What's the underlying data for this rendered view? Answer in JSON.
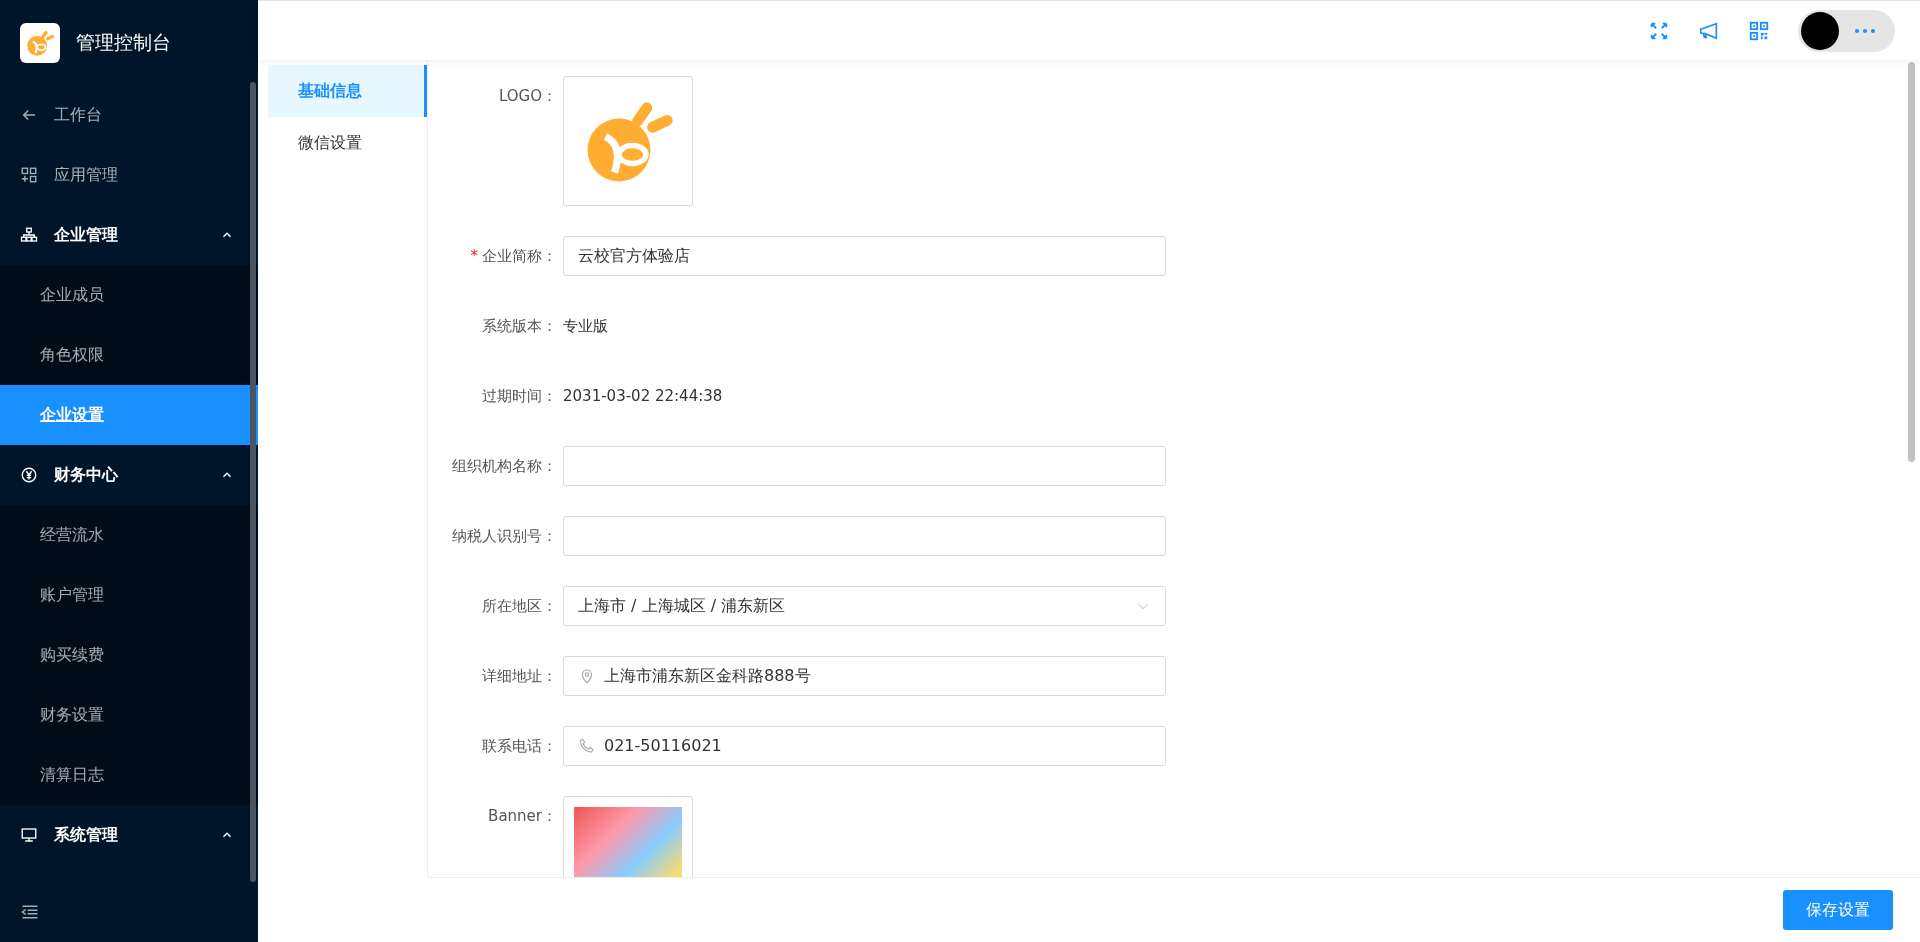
{
  "app": {
    "title": "管理控制台"
  },
  "sidebar": {
    "items": [
      {
        "kind": "back",
        "label": "工作台",
        "selected": false
      },
      {
        "kind": "item",
        "label": "应用管理",
        "selected": false
      },
      {
        "kind": "group",
        "label": "企业管理",
        "expanded": true,
        "children": [
          {
            "label": "企业成员",
            "selected": false
          },
          {
            "label": "角色权限",
            "selected": false
          },
          {
            "label": "企业设置",
            "selected": true
          }
        ]
      },
      {
        "kind": "group",
        "label": "财务中心",
        "expanded": true,
        "children": [
          {
            "label": "经营流水",
            "selected": false
          },
          {
            "label": "账户管理",
            "selected": false
          },
          {
            "label": "购买续费",
            "selected": false
          },
          {
            "label": "财务设置",
            "selected": false
          },
          {
            "label": "清算日志",
            "selected": false
          }
        ]
      },
      {
        "kind": "group",
        "label": "系统管理",
        "expanded": true
      }
    ]
  },
  "tabs": [
    {
      "label": "基础信息",
      "selected": true
    },
    {
      "label": "微信设置",
      "selected": false
    }
  ],
  "form": {
    "fields": [
      {
        "kind": "image",
        "label": "LOGO："
      },
      {
        "kind": "input",
        "label": "企业简称：",
        "required_mark": "*",
        "value": "云校官方体验店"
      },
      {
        "kind": "text",
        "label": "系统版本：",
        "value": "专业版"
      },
      {
        "kind": "text",
        "label": "过期时间：",
        "value": "2031-03-02 22:44:38"
      },
      {
        "kind": "input",
        "label": "组织机构名称："
      },
      {
        "kind": "input",
        "label": "纳税人识别号："
      },
      {
        "kind": "select",
        "label": "所在地区：",
        "value": "上海市 / 上海城区 / 浦东新区"
      },
      {
        "kind": "location",
        "label": "详细地址：",
        "value": "上海市浦东新区金科路888号"
      },
      {
        "kind": "phone",
        "label": "联系电话：",
        "value": "021-50116021"
      },
      {
        "kind": "banner",
        "label": "Banner："
      }
    ]
  },
  "footer": {
    "save_button": "保存设置"
  }
}
